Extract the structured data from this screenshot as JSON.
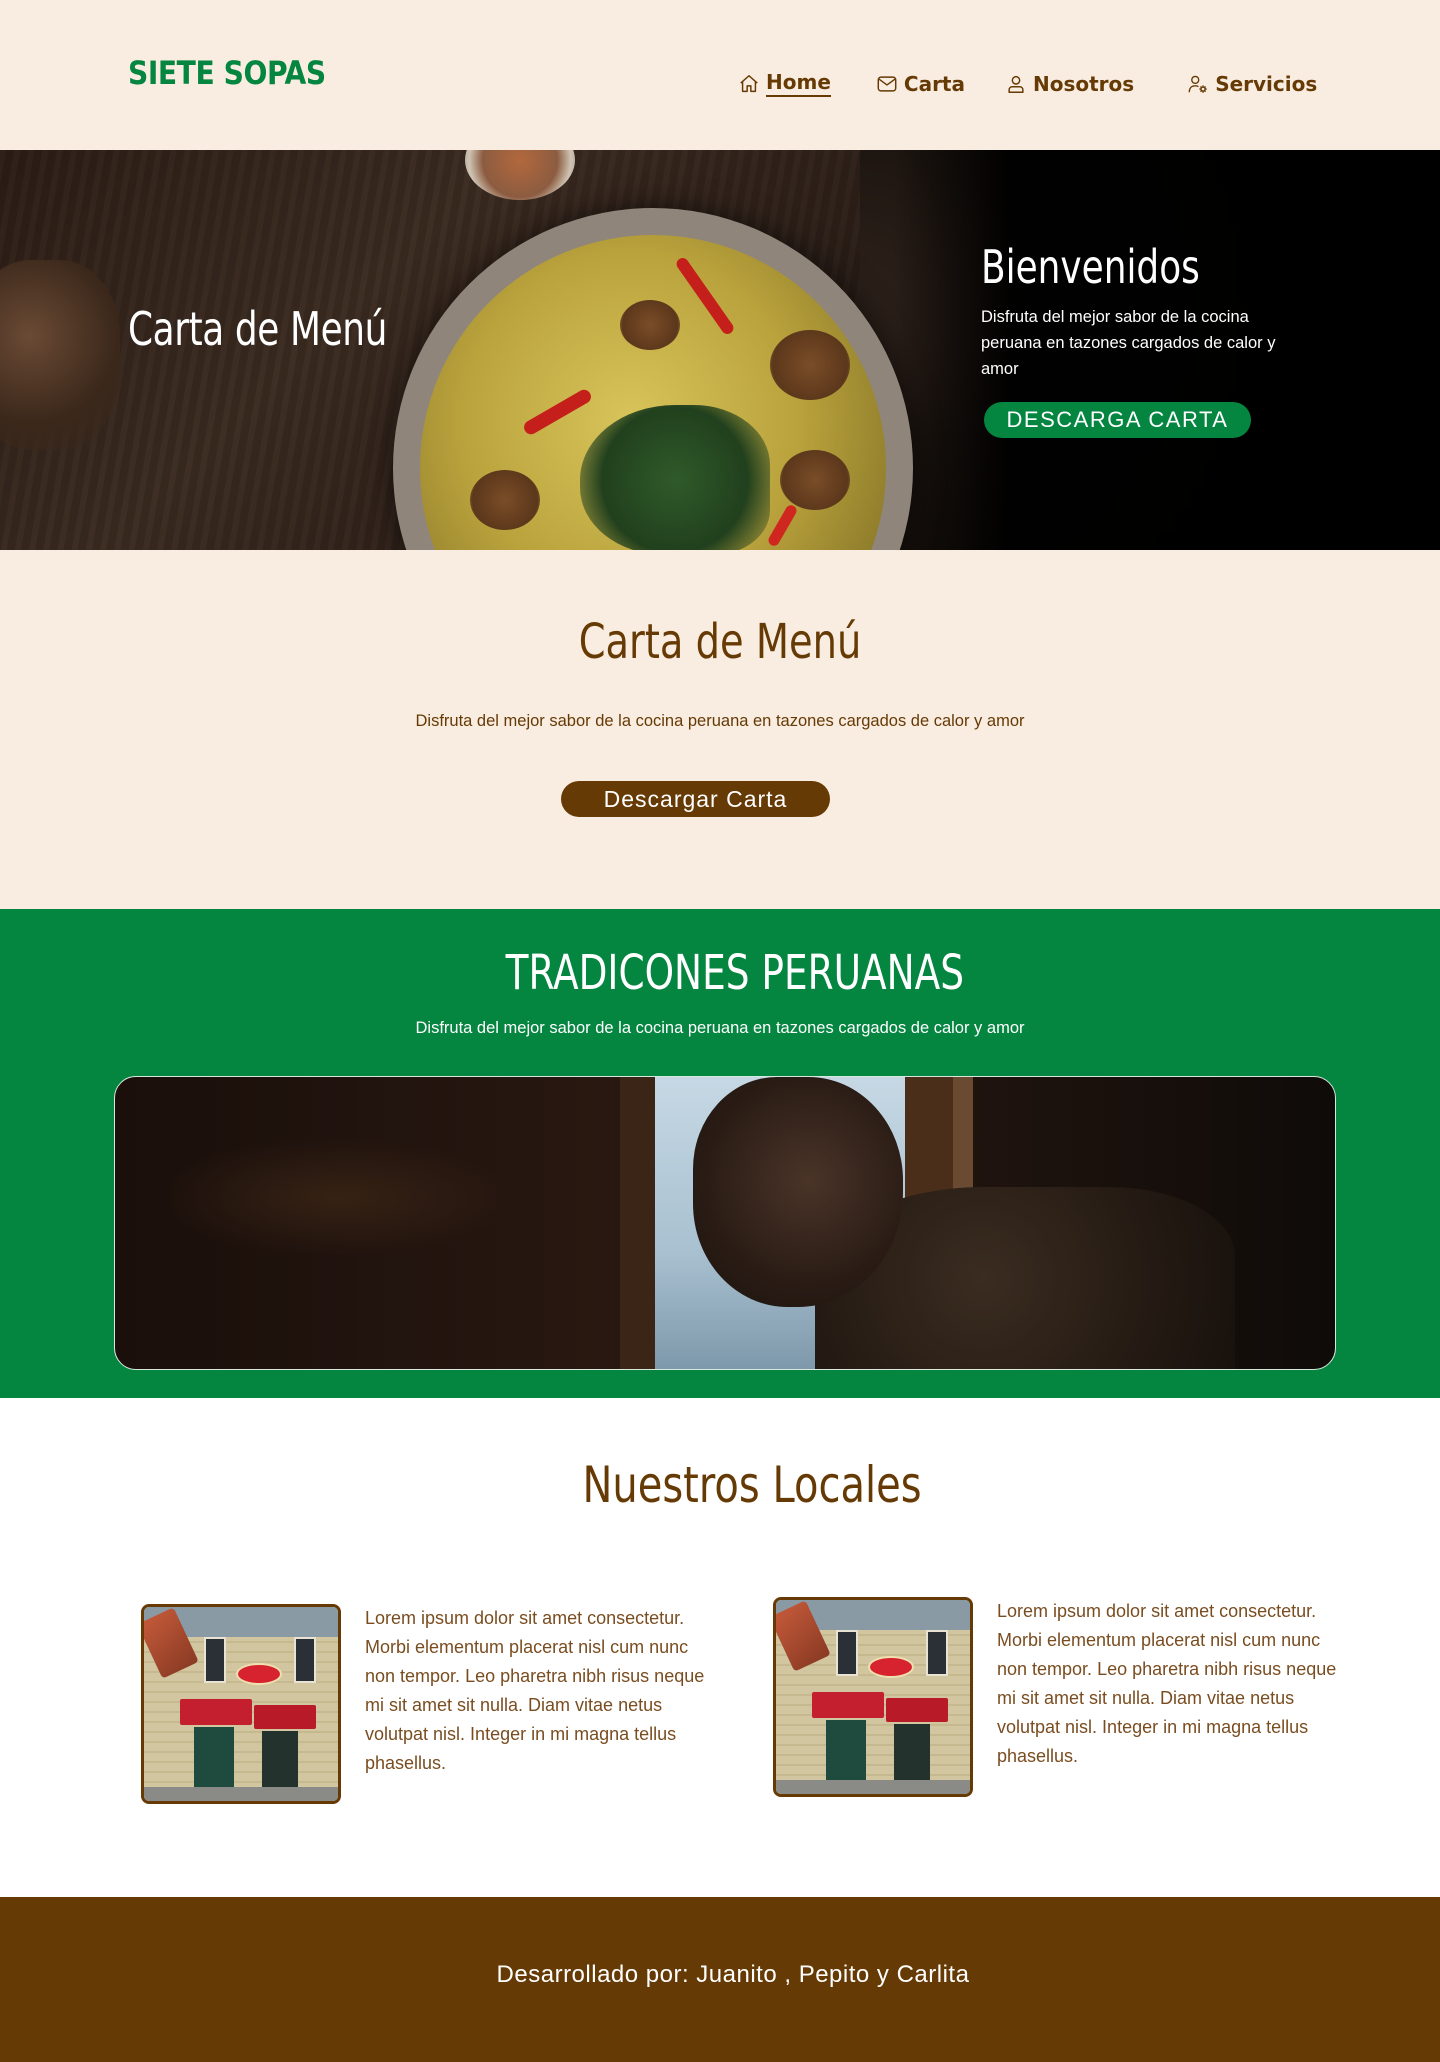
{
  "nav": {
    "logo": "SIETE SOPAS",
    "links": [
      {
        "label": "Home",
        "icon": "home-icon",
        "active": true
      },
      {
        "label": "Carta",
        "icon": "mail-icon",
        "active": false
      },
      {
        "label": "Nosotros",
        "icon": "user-icon",
        "active": false
      },
      {
        "label": "Servicios",
        "icon": "user-settings-icon",
        "active": false
      }
    ]
  },
  "hero": {
    "left_title": "Carta de Menú",
    "title": "Bienvenidos",
    "text": "Disfruta del mejor sabor de la cocina peruana en tazones cargados de calor y amor",
    "button": "DESCARGA CARTA"
  },
  "carta": {
    "title": "Carta de Menú",
    "text": "Disfruta del mejor sabor de la cocina peruana en tazones cargados de calor y amor",
    "button": "Descargar Carta"
  },
  "tradiciones": {
    "title": "TRADICONES PERUANAS",
    "text": "Disfruta del mejor sabor de la cocina peruana en tazones cargados de calor y amor"
  },
  "locales": {
    "title": "Nuestros Locales",
    "items": [
      {
        "text": "Lorem ipsum dolor sit amet consectetur. Morbi elementum placerat nisl cum nunc non tempor. Leo pharetra nibh risus neque mi sit amet sit nulla. Diam vitae netus volutpat nisl. Integer in mi magna tellus phasellus."
      },
      {
        "text": "Lorem ipsum dolor sit amet consectetur. Morbi elementum placerat nisl cum nunc non tempor. Leo pharetra nibh risus neque mi sit amet sit nulla. Diam vitae netus volutpat nisl. Integer in mi magna tellus phasellus."
      }
    ]
  },
  "footer": {
    "text": "Desarrollado por:  Juanito , Pepito y Carlita"
  },
  "colors": {
    "cream": "#f9ece0",
    "brown": "#663a05",
    "green": "#048540",
    "white": "#ffffff"
  }
}
